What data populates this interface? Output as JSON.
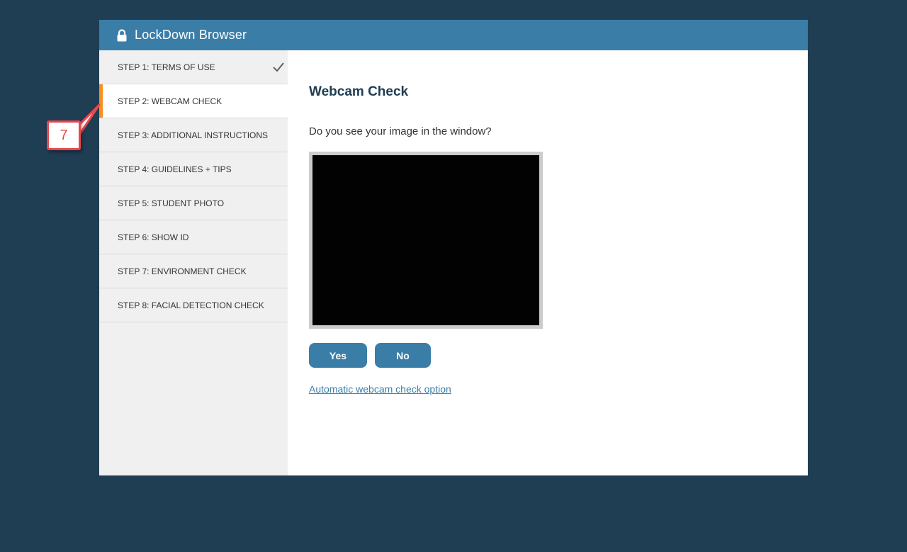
{
  "window": {
    "title": "LockDown Browser"
  },
  "sidebar": {
    "steps": [
      {
        "label": "STEP 1: TERMS OF USE",
        "completed": true,
        "active": false
      },
      {
        "label": "STEP 2: WEBCAM CHECK",
        "completed": false,
        "active": true
      },
      {
        "label": "STEP 3: ADDITIONAL INSTRUCTIONS",
        "completed": false,
        "active": false
      },
      {
        "label": "STEP 4: GUIDELINES + TIPS",
        "completed": false,
        "active": false
      },
      {
        "label": "STEP 5: STUDENT PHOTO",
        "completed": false,
        "active": false
      },
      {
        "label": "STEP 6: SHOW ID",
        "completed": false,
        "active": false
      },
      {
        "label": "STEP 7: ENVIRONMENT CHECK",
        "completed": false,
        "active": false
      },
      {
        "label": "STEP 8: FACIAL DETECTION CHECK",
        "completed": false,
        "active": false
      }
    ]
  },
  "main": {
    "heading": "Webcam Check",
    "question": "Do you see your image in the window?",
    "yes_label": "Yes",
    "no_label": "No",
    "auto_check_link": "Automatic webcam check option"
  },
  "annotation": {
    "number": "7"
  },
  "icons": {
    "lock": "lock-icon",
    "check": "checkmark-icon"
  },
  "colors": {
    "background": "#1f3d53",
    "titlebar": "#3a7ea8",
    "accent": "#f7901e",
    "annotation": "#e8474c"
  }
}
